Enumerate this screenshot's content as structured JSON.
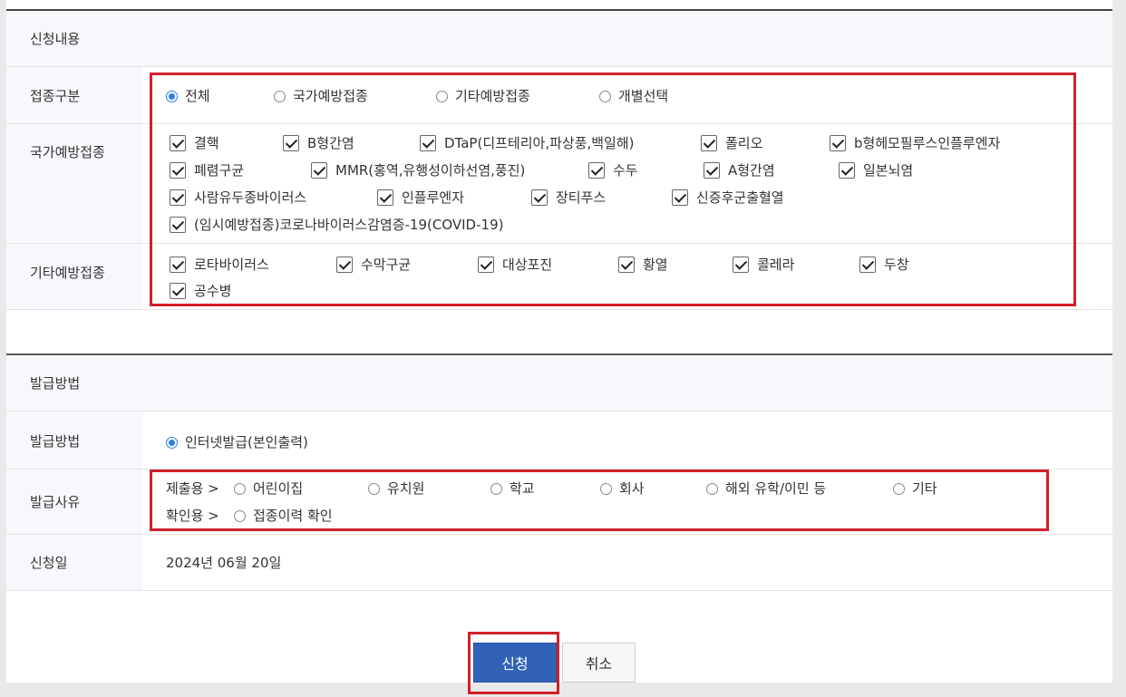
{
  "section1": {
    "title": "신청내용",
    "type_row": {
      "label": "접종구분",
      "options": [
        {
          "label": "전체",
          "selected": true
        },
        {
          "label": "국가예방접종",
          "selected": false
        },
        {
          "label": "기타예방접종",
          "selected": false
        },
        {
          "label": "개별선택",
          "selected": false
        }
      ]
    },
    "national": {
      "label": "국가예방접종",
      "items": [
        "결핵",
        "B형간염",
        "DTaP(디프테리아,파상풍,백일해)",
        "폴리오",
        "b형헤모필루스인플루엔자",
        "폐렴구균",
        "MMR(홍역,유행성이하선염,풍진)",
        "수두",
        "A형간염",
        "일본뇌염",
        "사람유두종바이러스",
        "인플루엔자",
        "장티푸스",
        "신증후군출혈열",
        "(임시예방접종)코로나바이러스감염증-19(COVID-19)"
      ]
    },
    "other": {
      "label": "기타예방접종",
      "items": [
        "로타바이러스",
        "수막구균",
        "대상포진",
        "황열",
        "콜레라",
        "두창",
        "공수병"
      ]
    }
  },
  "section2": {
    "title": "발급방법",
    "method_row": {
      "label": "발급방법",
      "option": "인터넷발급(본인출력)"
    },
    "reason_row": {
      "label": "발급사유",
      "submit_prefix": "제출용 >",
      "submit_options": [
        "어린이집",
        "유치원",
        "학교",
        "회사",
        "해외 유학/이민 등",
        "기타"
      ],
      "confirm_prefix": "확인용 >",
      "confirm_options": [
        "접종이력 확인"
      ]
    },
    "date_row": {
      "label": "신청일",
      "value": "2024년 06월 20일"
    }
  },
  "buttons": {
    "submit": "신청",
    "cancel": "취소"
  },
  "colors": {
    "highlight": "#d3202a",
    "primary": "#3262b8",
    "radio_selected": "#2d7ee6"
  }
}
